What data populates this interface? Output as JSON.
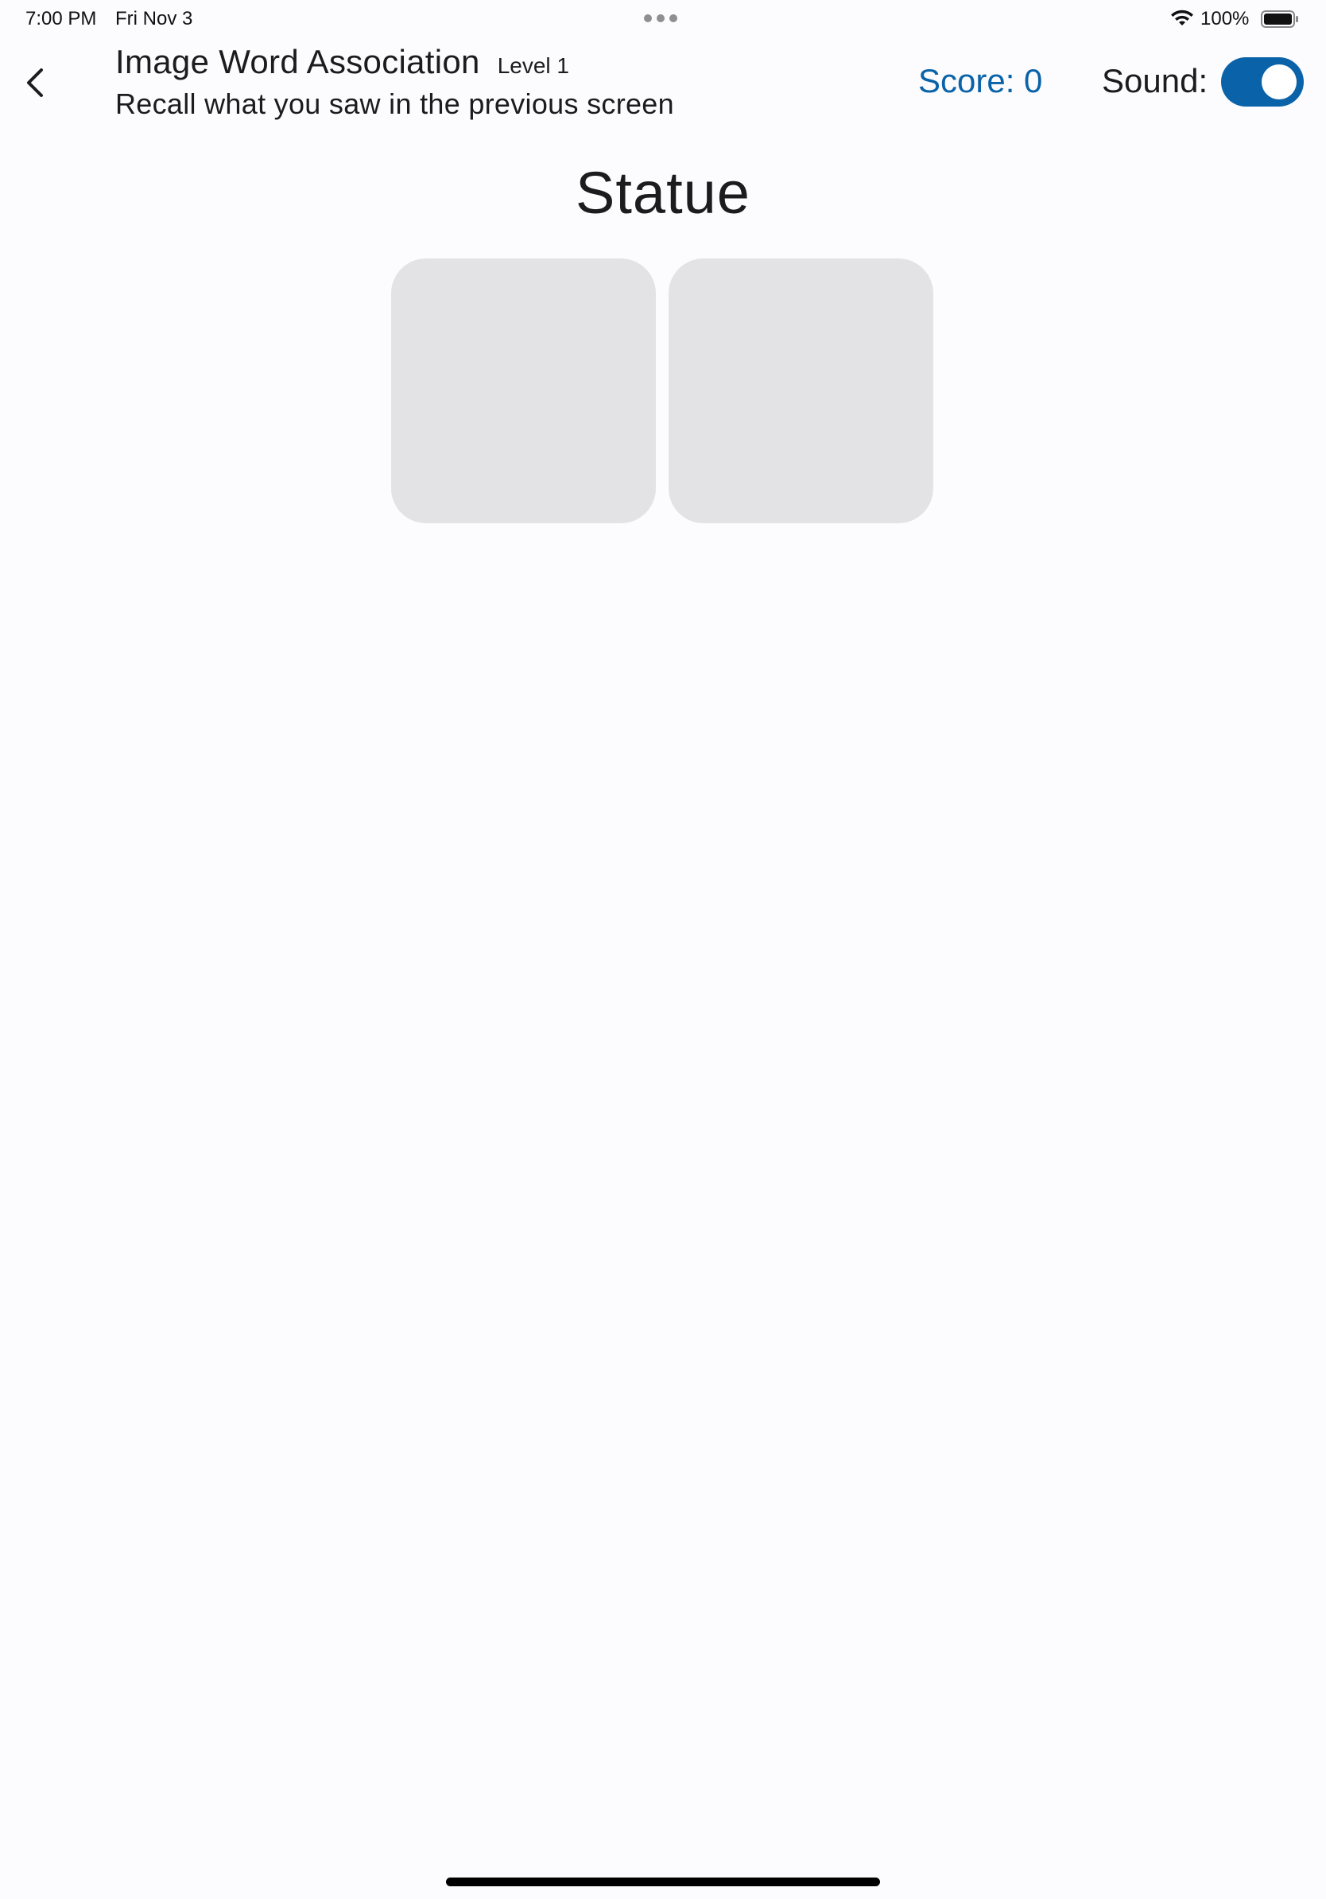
{
  "status_bar": {
    "time": "7:00 PM",
    "date": "Fri Nov 3",
    "battery_percent": "100%"
  },
  "header": {
    "title": "Image Word Association",
    "level": "Level 1",
    "subtitle": "Recall what you saw in the previous screen",
    "score": "Score: 0",
    "sound_label": "Sound:",
    "sound_on": true
  },
  "game": {
    "word": "Statue",
    "cards": [
      {
        "id": "card-1"
      },
      {
        "id": "card-2"
      }
    ]
  },
  "colors": {
    "accent": "#0a63a8",
    "card": "#e3e3e5",
    "background": "#fcfcfe"
  },
  "icons": {
    "back": "chevron-left-icon",
    "wifi": "wifi-icon",
    "battery": "battery-icon",
    "multitask": "more-dots-icon"
  }
}
